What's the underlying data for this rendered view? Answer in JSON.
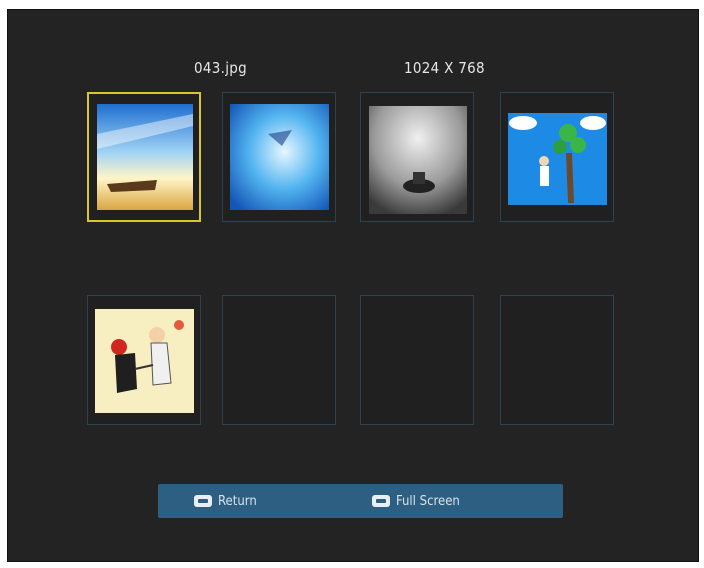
{
  "header": {
    "filename": "043.jpg",
    "resolution": "1024 X 768"
  },
  "thumbnails": [
    {
      "content": "boat-sky-photo",
      "selected": true
    },
    {
      "content": "blue-clouds-photo",
      "selected": false
    },
    {
      "content": "grey-spotlight-photo",
      "selected": false
    },
    {
      "content": "cartoon-tree-photo",
      "selected": false
    },
    {
      "content": "cartoon-dancers-photo",
      "selected": false
    },
    {
      "content": "empty",
      "selected": false
    },
    {
      "content": "empty",
      "selected": false
    },
    {
      "content": "empty",
      "selected": false
    }
  ],
  "footer": {
    "return_label": "Return",
    "return_icon": "return-key-icon",
    "fullscreen_label": "Full Screen",
    "fullscreen_icon": "ok-key-icon"
  },
  "colors": {
    "selection": "#d9c62a",
    "bar": "#2d5f82"
  }
}
